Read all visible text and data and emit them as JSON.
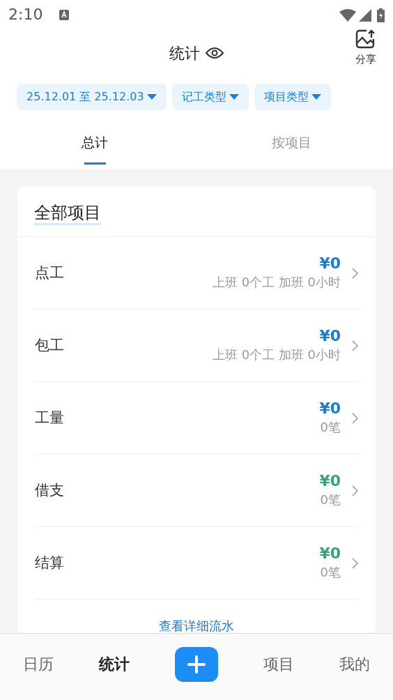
{
  "status_bar": {
    "time": "2:10"
  },
  "header": {
    "title": "统计",
    "share_label": "分享"
  },
  "filters": [
    {
      "label": "25.12.01 至 25.12.03"
    },
    {
      "label": "记工类型"
    },
    {
      "label": "项目类型"
    }
  ],
  "tabs": [
    {
      "label": "总计",
      "selected": true
    },
    {
      "label": "按项目",
      "selected": false
    }
  ],
  "card": {
    "title": "全部项目",
    "rows": [
      {
        "name": "点工",
        "amount": "¥0",
        "color": "#1a7fd4",
        "detail": "上班 0个工 加班 0小时"
      },
      {
        "name": "包工",
        "amount": "¥0",
        "color": "#1a7fd4",
        "detail": "上班 0个工 加班 0小时"
      },
      {
        "name": "工量",
        "amount": "¥0",
        "color": "#1a7fd4",
        "detail": "0笔"
      },
      {
        "name": "借支",
        "amount": "¥0",
        "color": "#3aa57a",
        "detail": "0笔"
      },
      {
        "name": "结算",
        "amount": "¥0",
        "color": "#3aa57a",
        "detail": "0笔"
      }
    ],
    "link": "查看详细流水"
  },
  "bottom_nav": [
    {
      "label": "日历",
      "selected": false
    },
    {
      "label": "统计",
      "selected": true
    },
    {
      "kind": "add"
    },
    {
      "label": "项目",
      "selected": false
    },
    {
      "label": "我的",
      "selected": false
    }
  ]
}
